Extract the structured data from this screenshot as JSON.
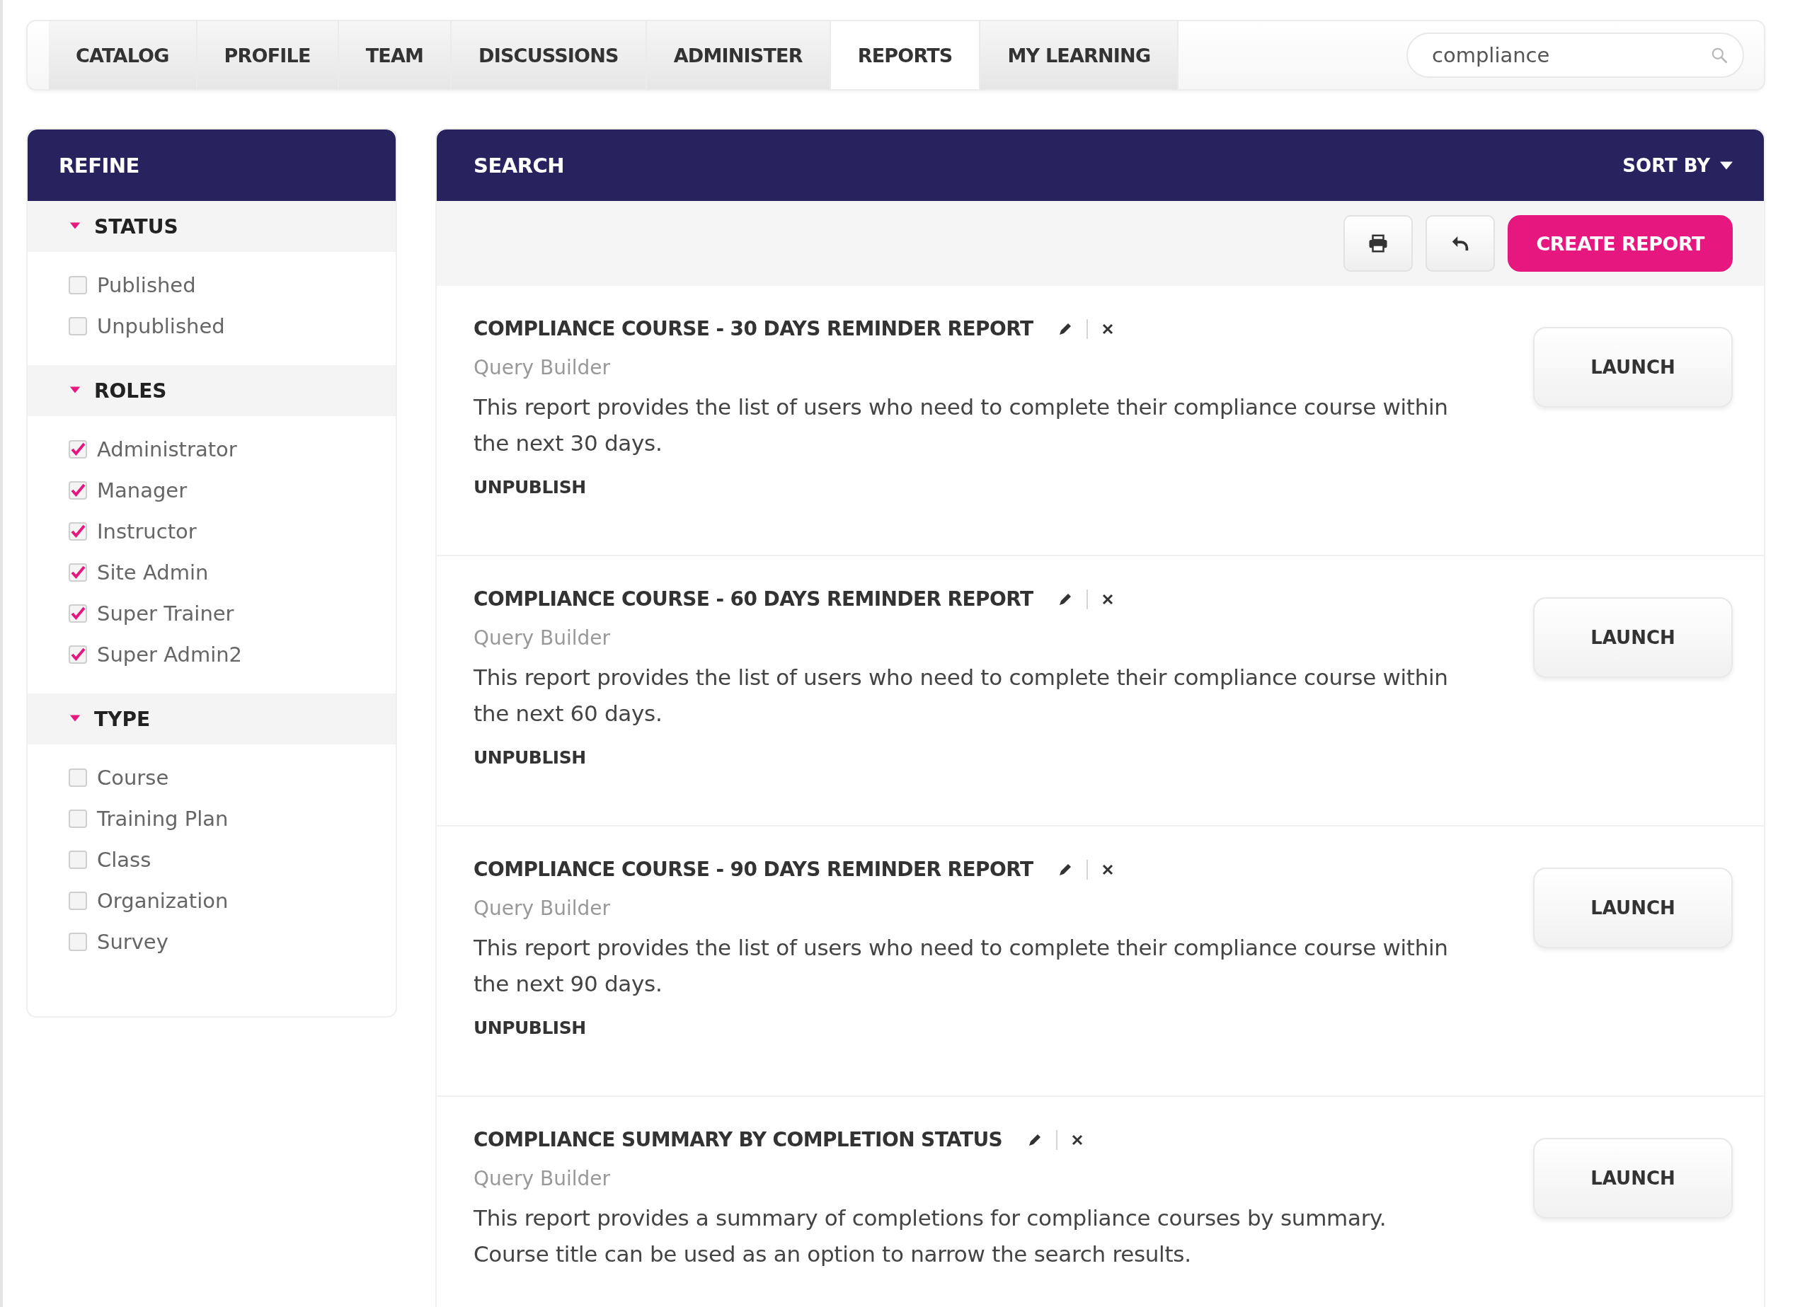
{
  "nav": {
    "tabs": [
      {
        "label": "CATALOG",
        "selected": false
      },
      {
        "label": "PROFILE",
        "selected": false
      },
      {
        "label": "TEAM",
        "selected": false
      },
      {
        "label": "DISCUSSIONS",
        "selected": false
      },
      {
        "label": "ADMINISTER",
        "selected": false
      },
      {
        "label": "REPORTS",
        "selected": true
      },
      {
        "label": "MY LEARNING",
        "selected": false
      }
    ],
    "search": {
      "value": "compliance"
    }
  },
  "refine": {
    "title": "REFINE",
    "sections": [
      {
        "title": "STATUS",
        "expanded": true,
        "items": [
          {
            "label": "Published",
            "checked": false
          },
          {
            "label": "Unpublished",
            "checked": false
          }
        ]
      },
      {
        "title": "ROLES",
        "expanded": true,
        "items": [
          {
            "label": "Administrator",
            "checked": true
          },
          {
            "label": "Manager",
            "checked": true
          },
          {
            "label": "Instructor",
            "checked": true
          },
          {
            "label": "Site Admin",
            "checked": true
          },
          {
            "label": "Super Trainer",
            "checked": true
          },
          {
            "label": "Super Admin2",
            "checked": true
          }
        ]
      },
      {
        "title": "TYPE",
        "expanded": true,
        "items": [
          {
            "label": "Course",
            "checked": false
          },
          {
            "label": "Training Plan",
            "checked": false
          },
          {
            "label": "Class",
            "checked": false
          },
          {
            "label": "Organization",
            "checked": false
          },
          {
            "label": "Survey",
            "checked": false
          }
        ]
      }
    ]
  },
  "results": {
    "title": "SEARCH",
    "sort_label": "SORT BY",
    "create_button": "CREATE REPORT",
    "reports": [
      {
        "title": "COMPLIANCE COURSE - 30 DAYS REMINDER REPORT",
        "source": "Query Builder",
        "description": "This report provides the list of users who need to complete their compliance course within the next 30 days.",
        "action": "UNPUBLISH",
        "launch": "LAUNCH"
      },
      {
        "title": "COMPLIANCE COURSE - 60 DAYS REMINDER REPORT",
        "source": "Query Builder",
        "description": "This report provides the list of users who need to complete their compliance course within the next 60 days.",
        "action": "UNPUBLISH",
        "launch": "LAUNCH"
      },
      {
        "title": "COMPLIANCE COURSE - 90 DAYS REMINDER REPORT",
        "source": "Query Builder",
        "description": "This report provides the list of users who need to complete their compliance course within the next 90 days.",
        "action": "UNPUBLISH",
        "launch": "LAUNCH"
      },
      {
        "title": "COMPLIANCE SUMMARY BY COMPLETION STATUS",
        "source": "Query Builder",
        "description": "This report provides a summary of completions for compliance courses by summary. Course title can be used as an option to narrow the search results.",
        "launch": "LAUNCH"
      }
    ]
  }
}
